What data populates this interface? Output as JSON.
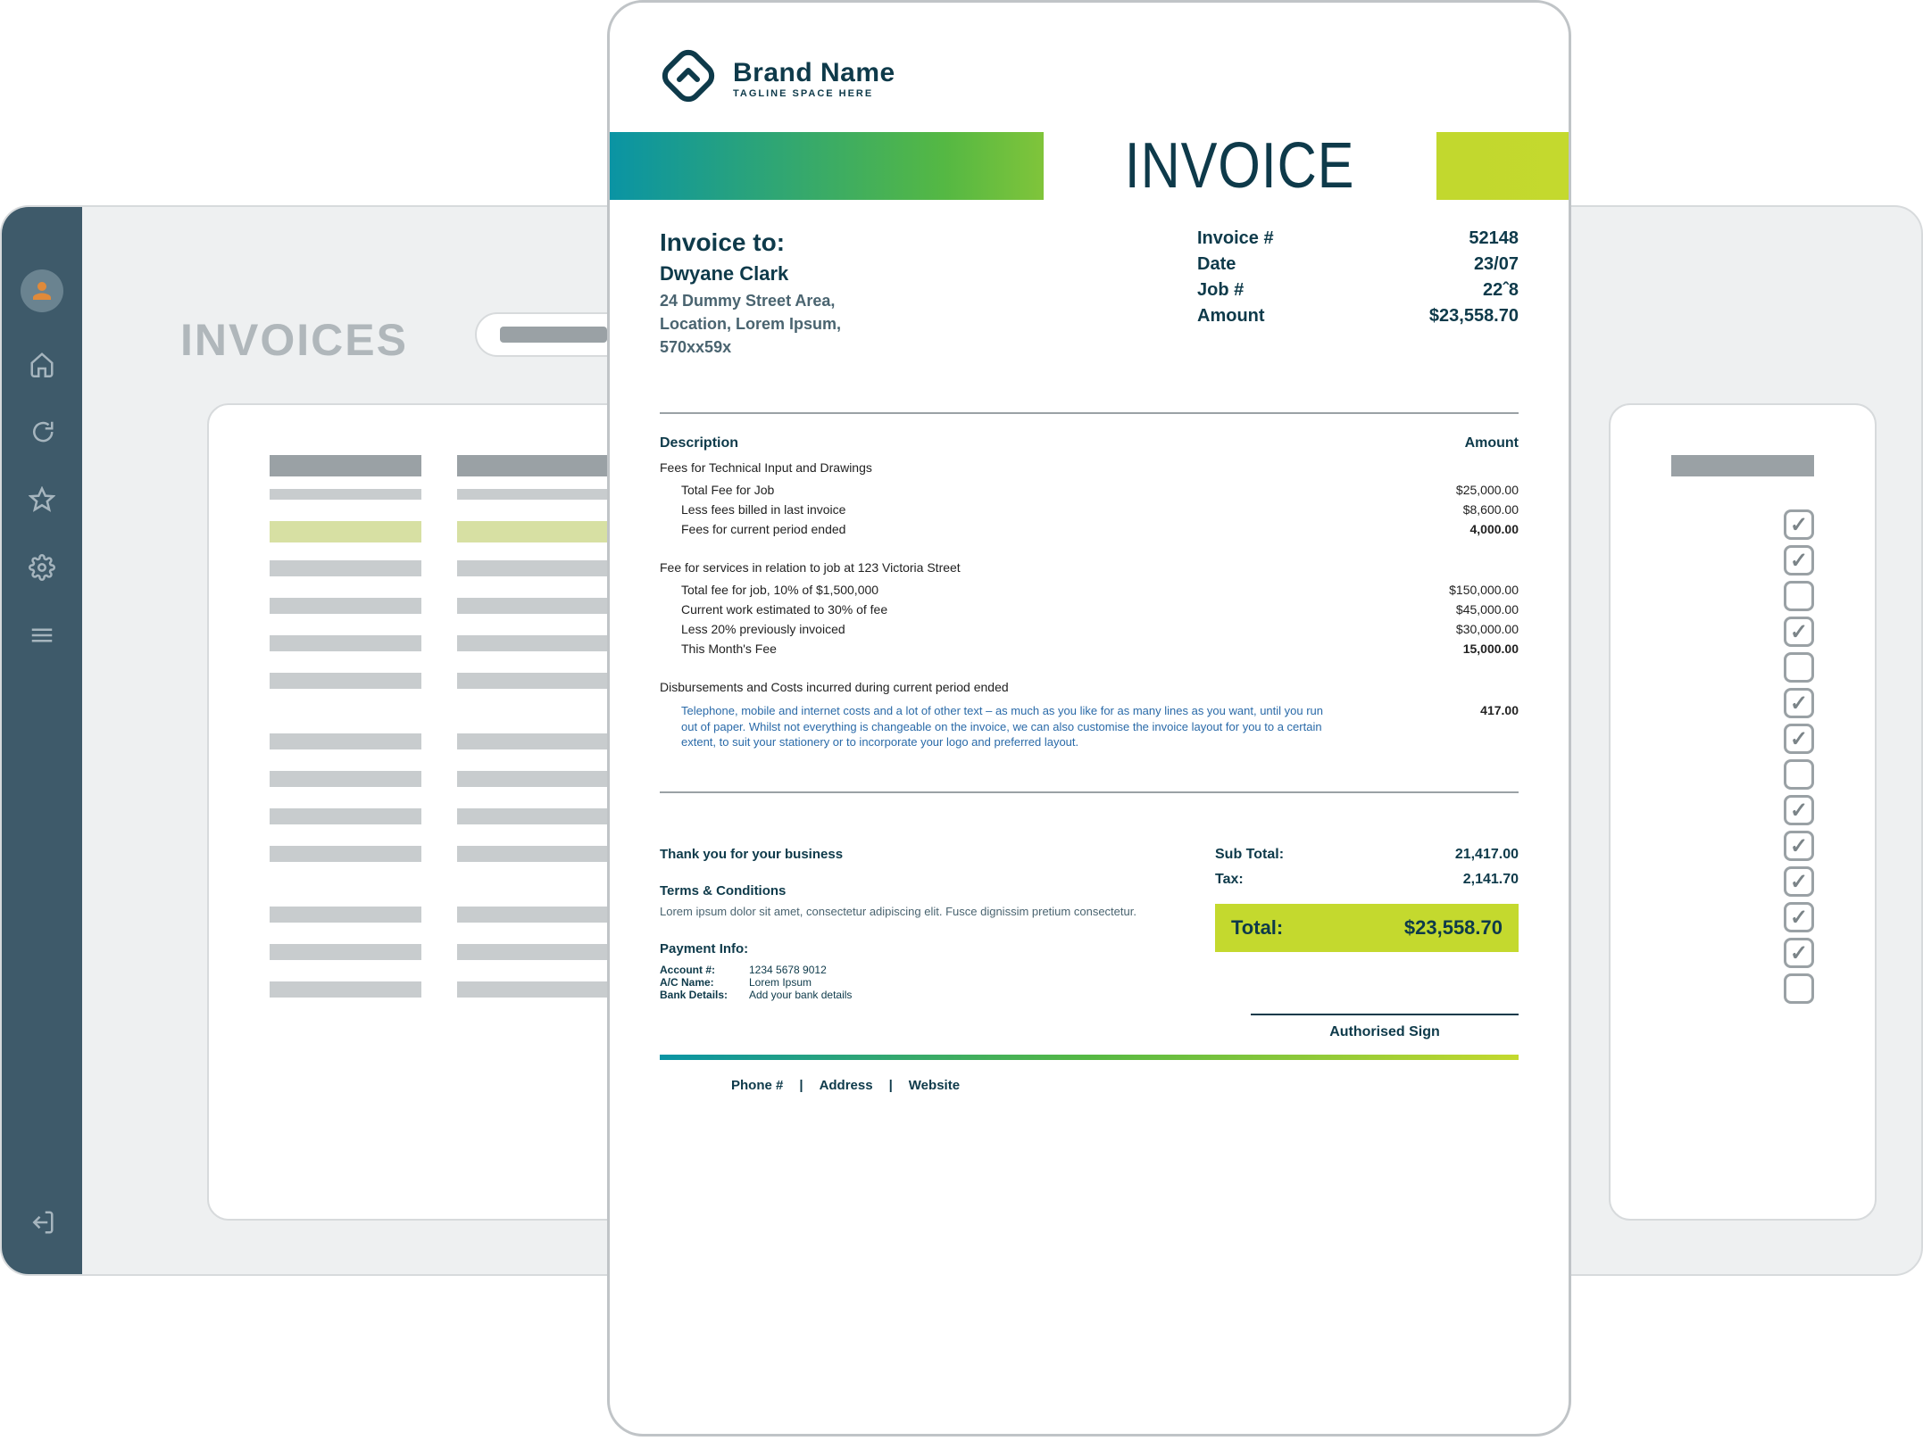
{
  "back": {
    "page_title": "INVOICES",
    "checkbox_states": [
      true,
      true,
      false,
      true,
      false,
      true,
      true,
      false,
      true,
      true,
      true,
      true,
      true,
      false
    ]
  },
  "brand": {
    "name": "Brand Name",
    "tagline": "TAGLINE SPACE HERE"
  },
  "banner_title": "INVOICE",
  "bill_to": {
    "label": "Invoice to:",
    "name": "Dwyane Clark",
    "address_line1": "24 Dummy Street Area,",
    "address_line2": "Location, Lorem Ipsum,",
    "address_line3": "570xx59x"
  },
  "meta": {
    "invoice_no_label": "Invoice #",
    "invoice_no": "52148",
    "date_label": "Date",
    "date": "23/07",
    "job_no_label": "Job #",
    "job_no": "22ˆ8",
    "amount_label": "Amount",
    "amount": "$23,558.70"
  },
  "items_header": {
    "desc": "Description",
    "amount": "Amount"
  },
  "sections": [
    {
      "head": "Fees for Technical Input and Drawings",
      "lines": [
        {
          "desc": "Total Fee for Job",
          "amt": "$25,000.00"
        },
        {
          "desc": "Less fees billed in last invoice",
          "amt": "$8,600.00"
        },
        {
          "desc": "Fees for current period ended",
          "amt": "4,000.00",
          "bold": true
        }
      ]
    },
    {
      "head": "Fee for services in relation to job at 123 Victoria Street",
      "lines": [
        {
          "desc": "Total fee for job, 10% of $1,500,000",
          "amt": "$150,000.00"
        },
        {
          "desc": "Current work estimated to 30% of fee",
          "amt": "$45,000.00"
        },
        {
          "desc": "Less 20% previously invoiced",
          "amt": "$30,000.00"
        },
        {
          "desc": "This Month's Fee",
          "amt": "15,000.00",
          "bold": true
        }
      ]
    },
    {
      "head": "Disbursements and Costs incurred during current period ended",
      "note": "Telephone, mobile and internet costs and a lot of other text – as much as you like for as many lines as you want, until you run out of paper. Whilst not everything is changeable on the invoice, we can also customise the invoice layout for you to a certain extent, to suit your stationery or to incorporate your logo and preferred layout.",
      "note_amt": "417.00"
    }
  ],
  "footer": {
    "thanks": "Thank you for your business",
    "tc_head": "Terms & Conditions",
    "tc_body": "Lorem ipsum dolor sit amet, consectetur adipiscing elit. Fusce dignissim pretium consectetur.",
    "pay_head": "Payment Info:",
    "pay_rows": [
      {
        "k": "Account #:",
        "v": "1234 5678 9012"
      },
      {
        "k": "A/C Name:",
        "v": "Lorem Ipsum"
      },
      {
        "k": "Bank Details:",
        "v": "Add your bank details"
      }
    ],
    "subtotal_label": "Sub Total:",
    "subtotal": "21,417.00",
    "tax_label": "Tax:",
    "tax": "2,141.70",
    "total_label": "Total:",
    "total": "$23,558.70",
    "sign_label": "Authorised Sign",
    "links": [
      "Phone #",
      "Address",
      "Website"
    ]
  }
}
